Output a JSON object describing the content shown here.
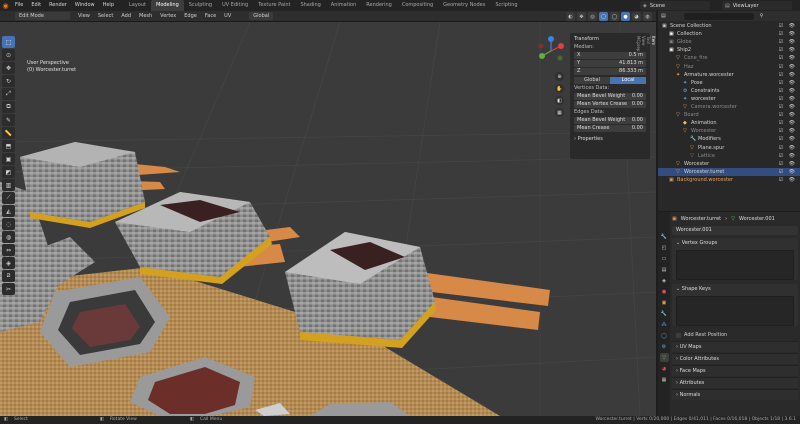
{
  "menu": [
    "File",
    "Edit",
    "Render",
    "Window",
    "Help"
  ],
  "workspaces": [
    "Layout",
    "Modeling",
    "Sculpting",
    "UV Editing",
    "Texture Paint",
    "Shading",
    "Animation",
    "Rendering",
    "Compositing",
    "Geometry Nodes",
    "Scripting"
  ],
  "active_workspace": "Modeling",
  "scene": "Scene",
  "view_layer": "ViewLayer",
  "viewport_header": {
    "mode": "Edit Mode",
    "menus": [
      "View",
      "Select",
      "Add",
      "Mesh",
      "Vertex",
      "Edge",
      "Face",
      "UV"
    ],
    "orientation": "Global"
  },
  "viewport_info": {
    "line1": "User Perspective",
    "line2": "(0) Worcester.turret"
  },
  "transform_panel": {
    "title": "Transform",
    "median_label": "Median:",
    "x_label": "X",
    "x_value": "0.5 m",
    "y_label": "Y",
    "y_value": "41.813 m",
    "z_label": "Z",
    "z_value": "86.333 m",
    "global_label": "Global",
    "local_label": "Local",
    "vertices_data": "Vertices Data:",
    "mean_bevel_weight_label": "Mean Bevel Weight",
    "mean_bevel_weight_v": "0.00",
    "mean_vertex_crease_label": "Mean Vertex Crease",
    "mean_vertex_crease": "0.00",
    "edges_data": "Edges Data:",
    "edge_bevel_label": "Mean Bevel Weight",
    "edge_bevel": "0.00",
    "mean_crease_label": "Mean Crease",
    "mean_crease": "0.00",
    "properties": "Properties"
  },
  "n_tabs": [
    "Item",
    "Tool",
    "View",
    "MCprep"
  ],
  "outliner": {
    "rows": [
      {
        "name": "Scene Collection",
        "indent": 0,
        "icon": "▣",
        "iconColor": "#cccccc"
      },
      {
        "name": "Collection",
        "indent": 1,
        "icon": "▣",
        "iconColor": "#ffffff"
      },
      {
        "name": "Globe",
        "indent": 1,
        "icon": "▣",
        "iconColor": "#888888",
        "dim": true
      },
      {
        "name": "Ship2",
        "indent": 1,
        "icon": "▣",
        "iconColor": "#ffffff"
      },
      {
        "name": "Cone_fire",
        "indent": 2,
        "icon": "▽",
        "iconColor": "#e8a060",
        "dim": true
      },
      {
        "name": "Haz",
        "indent": 2,
        "icon": "▽",
        "iconColor": "#e8a060",
        "dim": true
      },
      {
        "name": "Armature.worcester",
        "indent": 2,
        "icon": "✦",
        "iconColor": "#e8a060"
      },
      {
        "name": "Pose",
        "indent": 3,
        "icon": "✦",
        "iconColor": "#60a8e8"
      },
      {
        "name": "Constraints",
        "indent": 3,
        "icon": "⚙",
        "iconColor": "#60a8e8"
      },
      {
        "name": "worcester",
        "indent": 3,
        "icon": "✦",
        "iconColor": "#60a8e8"
      },
      {
        "name": "Camera.worcester",
        "indent": 3,
        "icon": "▽",
        "iconColor": "#e8a060",
        "dim": true
      },
      {
        "name": "Board",
        "indent": 2,
        "icon": "▽",
        "iconColor": "#e8a060",
        "dim": true
      },
      {
        "name": "Animation",
        "indent": 3,
        "icon": "◆",
        "iconColor": "#e8c060"
      },
      {
        "name": "Worcester",
        "indent": 3,
        "icon": "▽",
        "iconColor": "#e8a060",
        "dim": true
      },
      {
        "name": "Modifiers",
        "indent": 4,
        "icon": "🔧",
        "iconColor": "#60a8e8"
      },
      {
        "name": "Plane.spur",
        "indent": 4,
        "icon": "▽",
        "iconColor": "#e8a060"
      },
      {
        "name": "Lattice",
        "indent": 4,
        "icon": "▽",
        "iconColor": "#888888",
        "dim": true
      },
      {
        "name": "Worcester",
        "indent": 2,
        "icon": "▽",
        "iconColor": "#e8a060"
      },
      {
        "name": "Worcester.turret",
        "indent": 2,
        "icon": "▽",
        "iconColor": "#e8a060",
        "selected": true
      },
      {
        "name": "Background.worcester",
        "indent": 1,
        "icon": "▣",
        "iconColor": "#e8a060",
        "orange": true
      }
    ]
  },
  "properties": {
    "object_name": "Worcester.turret",
    "mesh_name": "Worcester.001",
    "mesh_data": "Worcester.001",
    "vertex_groups": "Vertex Groups",
    "shape_keys": "Shape Keys",
    "add_rest_position": "Add Rest Position",
    "collapsed": [
      "UV Maps",
      "Color Attributes",
      "Face Maps",
      "Attributes",
      "Normals"
    ]
  },
  "statusbar": {
    "select": "Select",
    "rotate": "Rotate View",
    "call_menu": "Call Menu",
    "stats": "Worcester.turret | Verts 0/20,000 | Edges 0/41,011 | Faces 0/16,018 | Objects 1/18 | 3.6.1"
  }
}
